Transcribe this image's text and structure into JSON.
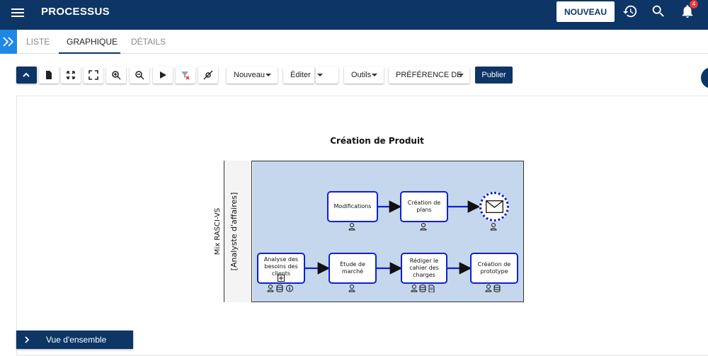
{
  "header": {
    "title": "PROCESSUS",
    "new_button": "NOUVEAU",
    "notification_count": "4"
  },
  "tabs": [
    {
      "label": "LISTE",
      "active": false
    },
    {
      "label": "GRAPHIQUE",
      "active": true
    },
    {
      "label": "DÉTAILS",
      "active": false
    }
  ],
  "toolbar": {
    "tools": [
      "collapse-icon",
      "document-icon",
      "fit-icon",
      "fullscreen-icon",
      "zoom-in-icon",
      "zoom-out-icon",
      "play-icon",
      "clear-filter-icon",
      "hide-icon"
    ],
    "new_menu": "Nouveau",
    "edit_menu": "Éditer",
    "tools_menu": "Outils",
    "preference_menu": "PRÉFÉRENCE DE",
    "publish": "Publier"
  },
  "diagram": {
    "title": "Création de Produit",
    "pool": "Mix RASCI-VS",
    "lane": "[Analyste d'affaires]",
    "tasks": [
      {
        "label": "Modifications"
      },
      {
        "label": "Création de plans"
      },
      {
        "label": "Analyse des besoins des clients"
      },
      {
        "label": "Étude de marché"
      },
      {
        "label": "Rédiger le cahier des charges"
      },
      {
        "label": "Création de prototype"
      }
    ],
    "event": "envelope-icon"
  },
  "overview": {
    "label": "Vue d'ensemble"
  },
  "colors": {
    "primary": "#0d3566",
    "lane": "#c5d7ec",
    "task_border": "#1020d0",
    "badge": "#e53935",
    "side_toggle": "#1e88e5"
  }
}
